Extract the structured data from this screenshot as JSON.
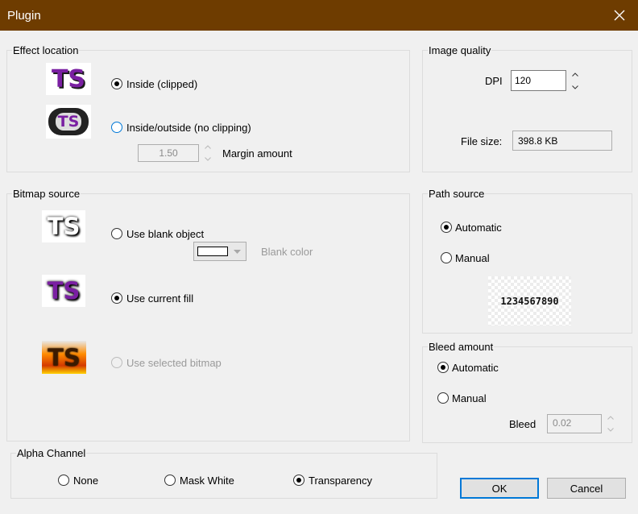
{
  "window": {
    "title": "Plugin"
  },
  "effect_location": {
    "legend": "Effect location",
    "inside_label": "Inside (clipped)",
    "inside_outside_label": "Inside/outside (no clipping)",
    "margin_value": "1.50",
    "margin_label": "Margin amount",
    "thumb_text": "TS"
  },
  "image_quality": {
    "legend": "Image quality",
    "dpi_label": "DPI",
    "dpi_value": "120",
    "file_size_label": "File size:",
    "file_size_value": "398.8 KB"
  },
  "bitmap_source": {
    "legend": "Bitmap source",
    "blank_object_label": "Use blank object",
    "blank_color_label": "Blank color",
    "current_fill_label": "Use current fill",
    "selected_bitmap_label": "Use selected bitmap",
    "thumb_text": "TS"
  },
  "path_source": {
    "legend": "Path source",
    "automatic_label": "Automatic",
    "manual_label": "Manual",
    "preview_text": "1234567890"
  },
  "bleed_amount": {
    "legend": "Bleed amount",
    "automatic_label": "Automatic",
    "manual_label": "Manual",
    "bleed_label": "Bleed",
    "bleed_value": "0.02"
  },
  "alpha_channel": {
    "legend": "Alpha Channel",
    "none_label": "None",
    "mask_white_label": "Mask White",
    "transparency_label": "Transparency"
  },
  "buttons": {
    "ok": "OK",
    "cancel": "Cancel"
  },
  "colors": {
    "titlebar": "#6e3c00",
    "accent": "#0078d7",
    "purple": "#7a1fa2"
  }
}
